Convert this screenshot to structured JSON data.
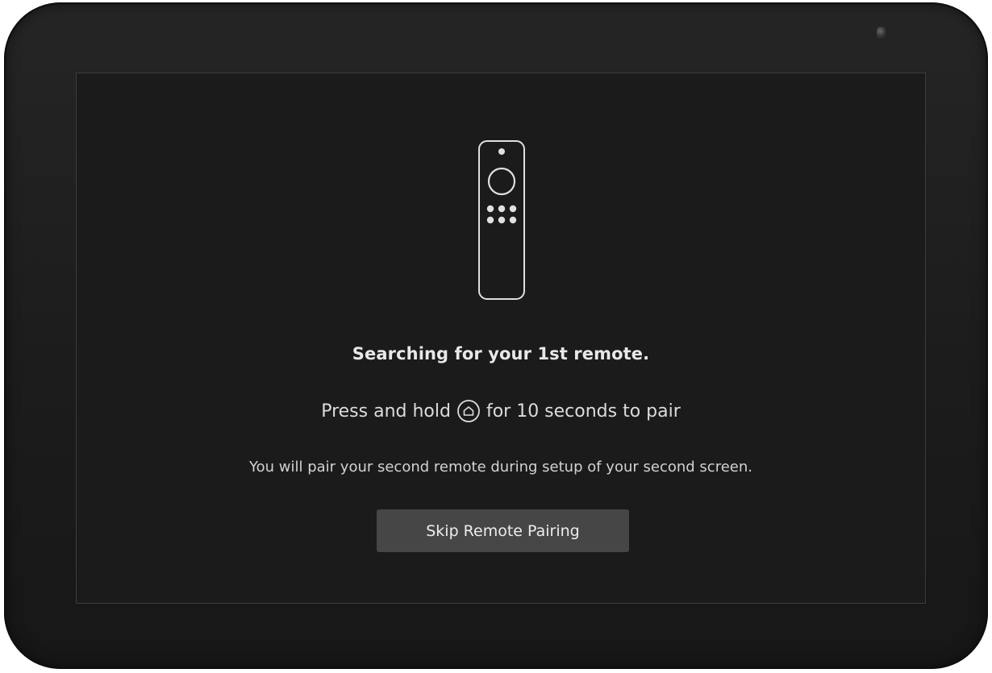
{
  "pairing": {
    "title": "Searching for your 1st remote.",
    "instruction_prefix": "Press and hold",
    "instruction_suffix": "for 10 seconds to pair",
    "note": "You will pair your second remote during setup of your second screen.",
    "skip_button_label": "Skip Remote Pairing"
  },
  "icons": {
    "remote": "fire-tv-remote-icon",
    "home": "home-button-icon",
    "camera": "camera-lens"
  },
  "colors": {
    "screen_background": "#1b1b1b",
    "bezel": "#1f1f1f",
    "button_background": "#464646",
    "text": "#e8e8e8"
  }
}
